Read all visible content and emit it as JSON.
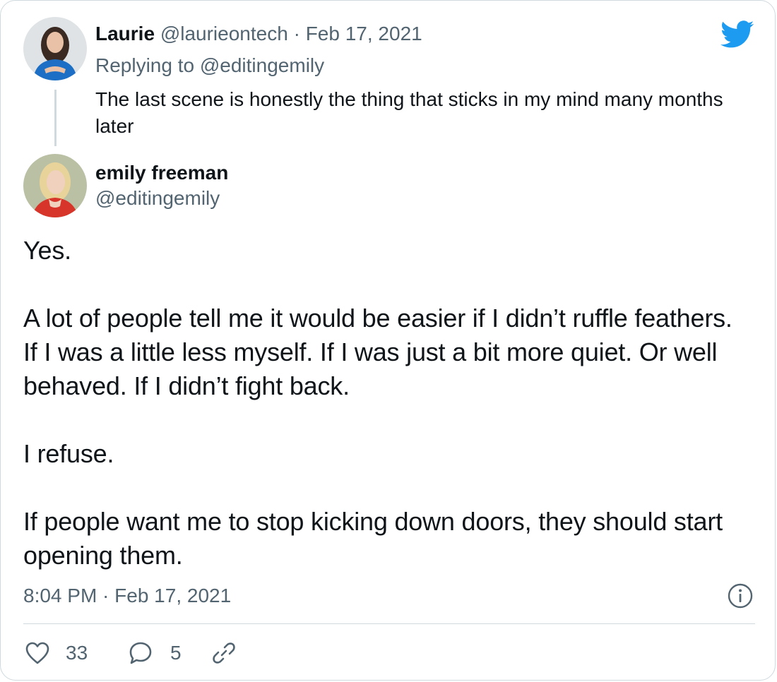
{
  "colors": {
    "twitter_blue": "#1d9bf0",
    "text_primary": "#0f1419",
    "text_secondary": "#536471",
    "border": "#cfd9de"
  },
  "parent_tweet": {
    "author_name": "Laurie",
    "author_handle": "@laurieontech",
    "separator": "·",
    "date": "Feb 17, 2021",
    "replying_to": "Replying to @editingemily",
    "text": "The last scene is honestly the thing that sticks in my mind many months later",
    "avatar_icon": "avatar-laurie"
  },
  "main_tweet": {
    "author_name": "emily freeman",
    "author_handle": "@editingemily",
    "avatar_icon": "avatar-emily",
    "text": "Yes.\n\nA lot of people tell me it would be easier if I didn’t ruffle feathers. If I was a little less myself. If I was just a bit more quiet. Or well behaved. If I didn’t fight back.\n\nI refuse.\n\nIf people want me to stop kicking down doors, they should start opening them.",
    "timestamp": "8:04 PM · Feb 17, 2021"
  },
  "actions": {
    "likes_count": "33",
    "replies_count": "5",
    "like_icon": "heart-icon",
    "reply_icon": "reply-bubble-icon",
    "share_icon": "link-icon"
  },
  "icons": {
    "logo": "twitter-bird-icon",
    "info": "info-icon"
  }
}
